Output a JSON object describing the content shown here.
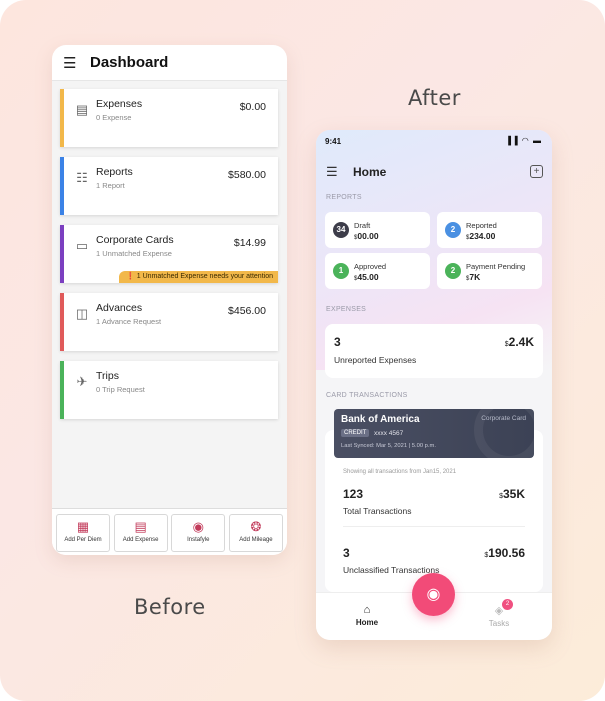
{
  "captions": {
    "after": "After",
    "before": "Before"
  },
  "before": {
    "header": {
      "title": "Dashboard"
    },
    "cards": [
      {
        "name": "Expenses",
        "sub": "0 Expense",
        "amount": "$0.00",
        "color": "#f2b84a",
        "icon": "receipt-icon"
      },
      {
        "name": "Reports",
        "sub": "1 Report",
        "amount": "$580.00",
        "color": "#3b82e6",
        "icon": "clipboard-icon"
      },
      {
        "name": "Corporate Cards",
        "sub": "1 Unmatched Expense",
        "amount": "$14.99",
        "color": "#7b3fc0",
        "icon": "credit-card-icon",
        "warning": "❗ 1 Unmatched Expense needs your attention"
      },
      {
        "name": "Advances",
        "sub": "1 Advance Request",
        "amount": "$456.00",
        "color": "#e05a5a",
        "icon": "wallet-icon"
      },
      {
        "name": "Trips",
        "sub": "0 Trip Request",
        "amount": "",
        "color": "#4bb35a",
        "icon": "plane-icon"
      }
    ],
    "bottom": [
      {
        "label": "Add Per Diem",
        "icon": "calendar-icon"
      },
      {
        "label": "Add Expense",
        "icon": "receipt-add-icon"
      },
      {
        "label": "Instafyle",
        "icon": "camera-icon"
      },
      {
        "label": "Add Mileage",
        "icon": "mileage-icon"
      }
    ]
  },
  "after": {
    "status": {
      "time": "9:41",
      "icons": "▐▐ ◠ ▬"
    },
    "header": {
      "title": "Home"
    },
    "sections": {
      "reports": "REPORTS",
      "expenses": "EXPENSES",
      "card_tx": "CARD TRANSACTIONS"
    },
    "reports": [
      {
        "badge": "34",
        "name": "Draft",
        "currency": "$",
        "value": "00.00",
        "color": "#3d3d4a"
      },
      {
        "badge": "2",
        "name": "Reported",
        "currency": "$",
        "value": "234.00",
        "color": "#4a90e2"
      },
      {
        "badge": "1",
        "name": "Approved",
        "currency": "$",
        "value": "45.00",
        "color": "#4bb35a"
      },
      {
        "badge": "2",
        "name": "Payment Pending",
        "currency": "$",
        "value": "7K",
        "color": "#4bb35a"
      }
    ],
    "expenses": {
      "count": "3",
      "label": "Unreported Expenses",
      "currency": "$",
      "amount": "2.4K"
    },
    "bank": {
      "name": "Bank of America",
      "type": "Corporate Card",
      "credit": "CREDIT",
      "number": "xxxx  4567",
      "synced": "Last Synced: Mar 5, 2021 | 5.00 p.m."
    },
    "transactions": {
      "showing": "Showing all transactions from Jan15, 2021",
      "total_count": "123",
      "total_label": "Total Transactions",
      "total_currency": "$",
      "total_amount": "35K",
      "unclassified_count": "3",
      "unclassified_label": "Unclassified Transactions",
      "unclassified_currency": "$",
      "unclassified_amount": "190.56"
    },
    "nav": {
      "home": "Home",
      "tasks": "Tasks",
      "tasks_badge": "2"
    }
  }
}
